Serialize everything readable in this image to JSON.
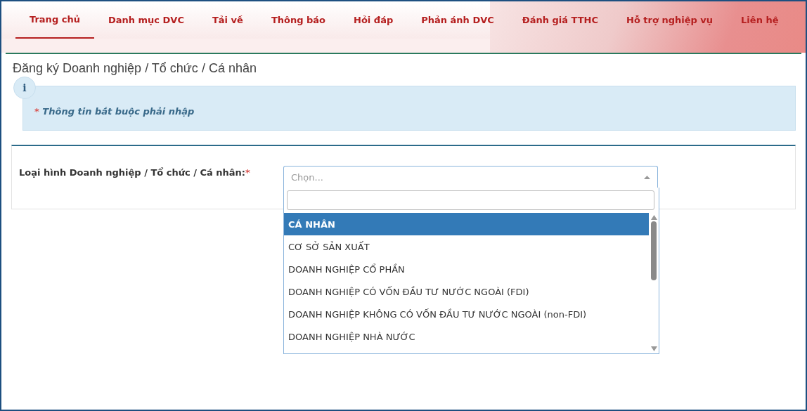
{
  "nav": [
    {
      "label": "Trang chủ",
      "selected": true
    },
    {
      "label": "Danh mục DVC",
      "selected": false
    },
    {
      "label": "Tải về",
      "selected": false
    },
    {
      "label": "Thông báo",
      "selected": false
    },
    {
      "label": "Hỏi đáp",
      "selected": false
    },
    {
      "label": "Phản ánh DVC",
      "selected": false
    },
    {
      "label": "Đánh giá TTHC",
      "selected": false
    },
    {
      "label": "Hỗ trợ nghiệp vụ",
      "selected": false
    },
    {
      "label": "Liên hệ",
      "selected": false
    }
  ],
  "page_title": "Đăng ký Doanh nghiệp / Tổ chức / Cá nhân",
  "notice": {
    "icon": "i",
    "required_mark": "*",
    "text": "Thông tin bắt buộc phải nhập"
  },
  "form": {
    "label": "Loại hình Doanh nghiệp / Tổ chức / Cá nhân:",
    "required_mark": "*",
    "select": {
      "placeholder": "Chọn...",
      "expanded": true,
      "options": [
        {
          "label": "CÁ NHÂN",
          "selected": true
        },
        {
          "label": "CƠ SỞ SẢN XUẤT",
          "selected": false
        },
        {
          "label": "DOANH NGHIỆP CỔ PHẦN",
          "selected": false
        },
        {
          "label": "DOANH NGHIỆP CÓ VỐN ĐẦU TƯ NƯỚC NGOÀI (FDI)",
          "selected": false
        },
        {
          "label": "DOANH NGHIỆP KHÔNG CÓ VỐN ĐẦU TƯ NƯỚC NGOÀI (non-FDI)",
          "selected": false
        },
        {
          "label": "DOANH NGHIỆP NHÀ NƯỚC",
          "selected": false
        }
      ]
    }
  }
}
